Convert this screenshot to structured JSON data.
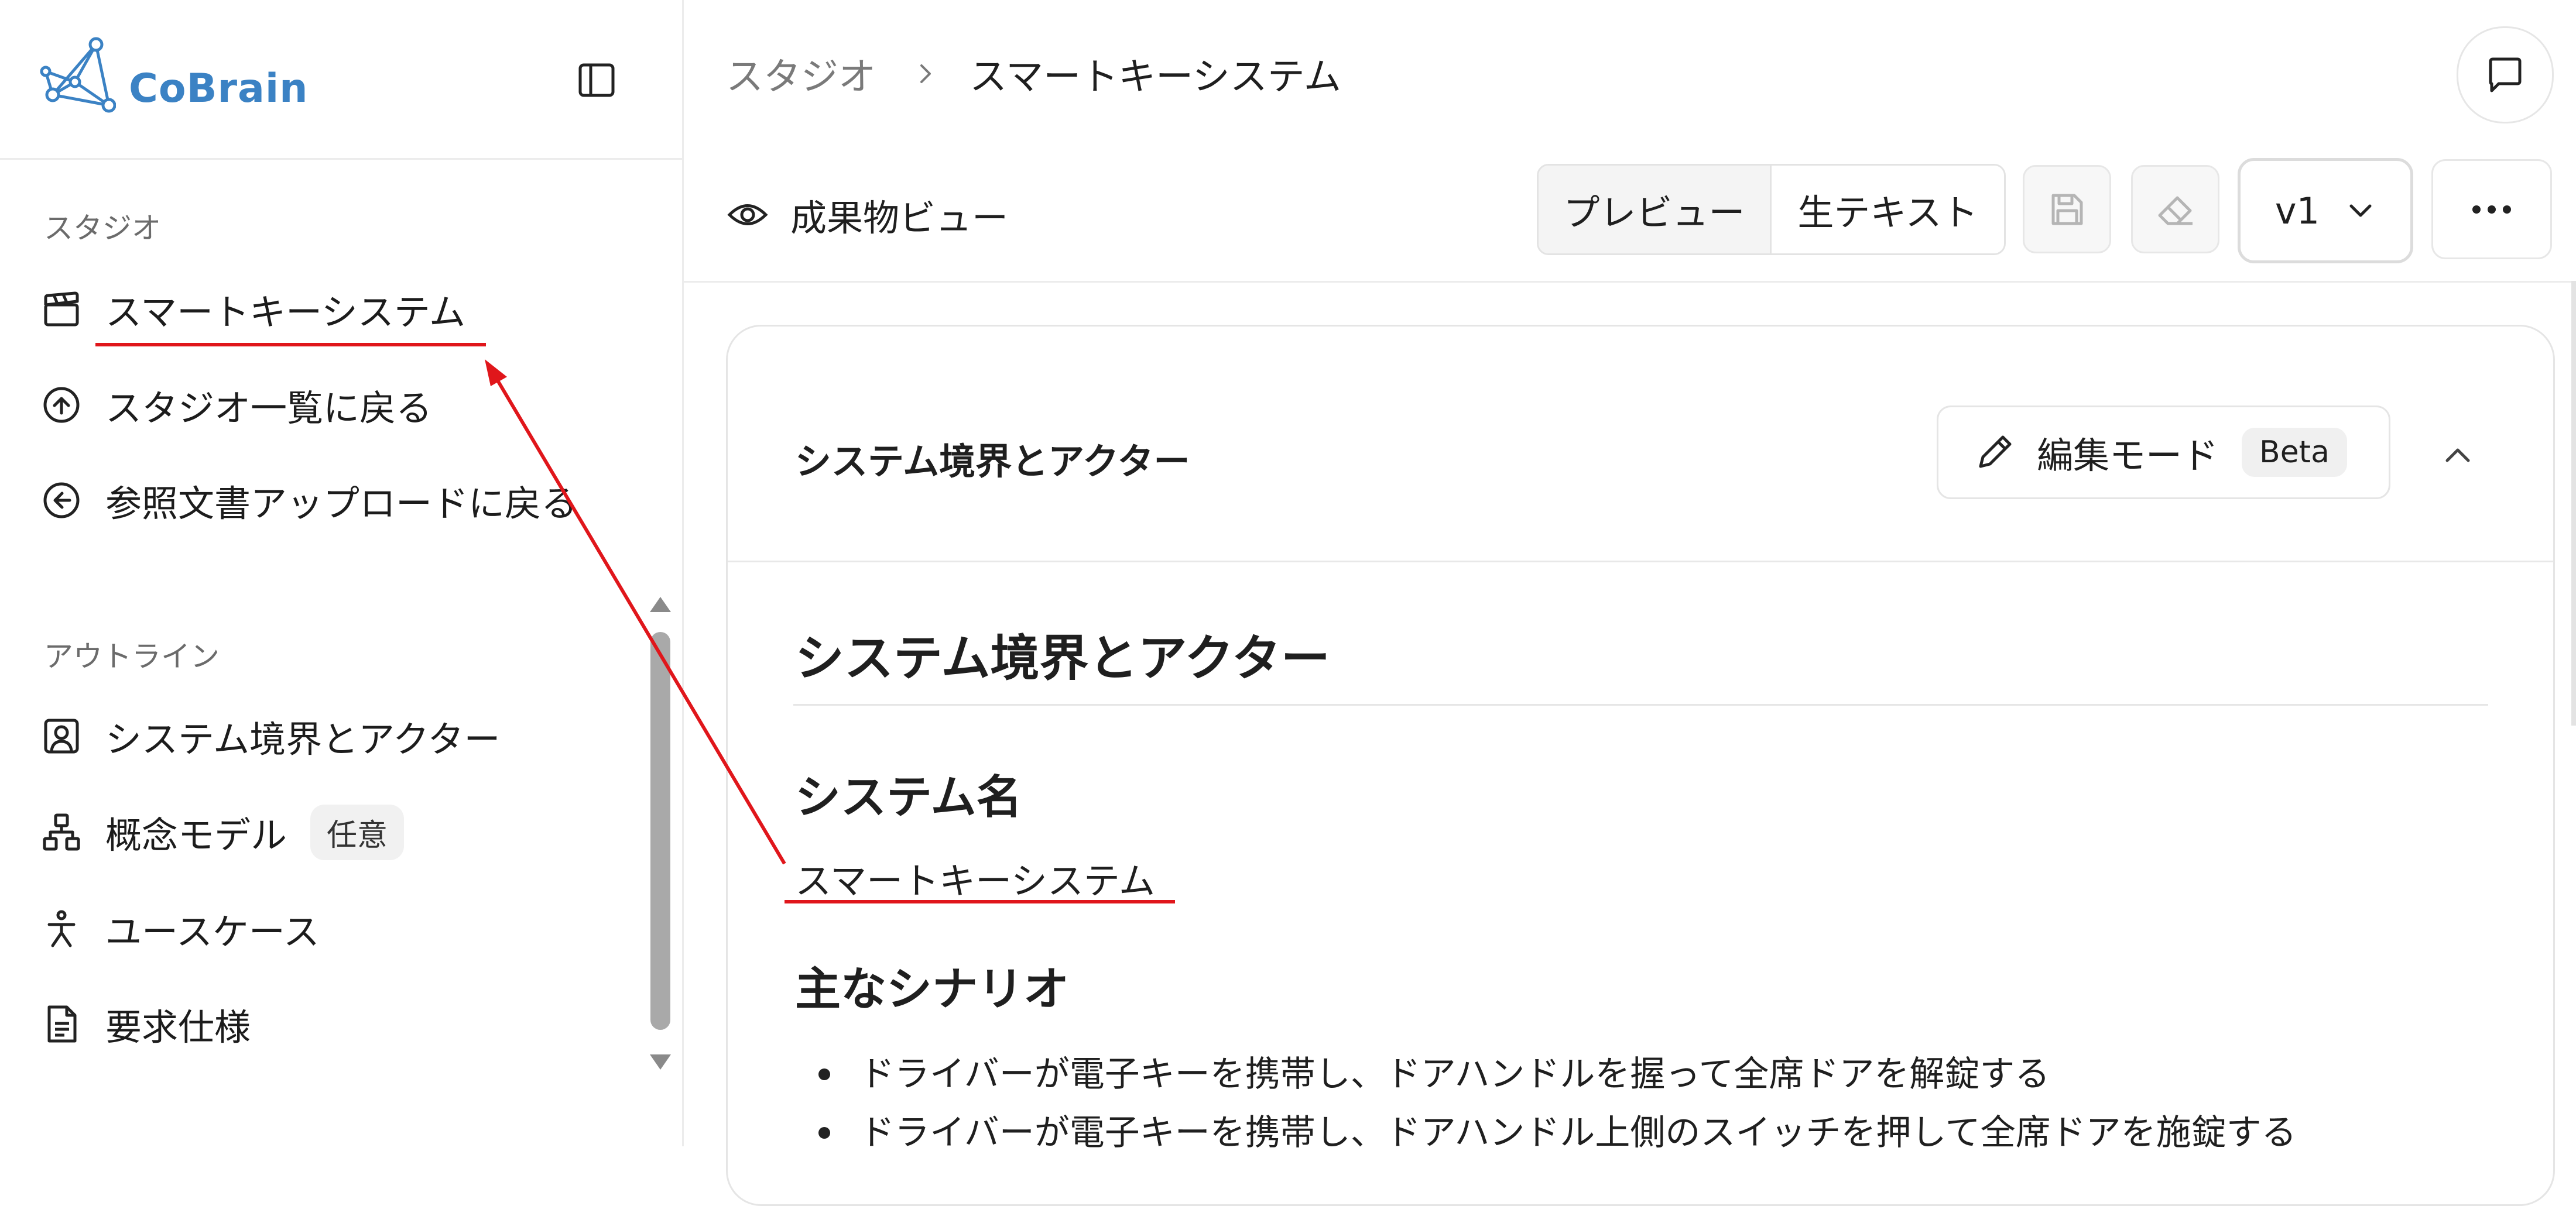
{
  "app": {
    "name": "CoBrain"
  },
  "sidebar": {
    "studio_section": "スタジオ",
    "studio_items": [
      {
        "label": "スマートキーシステム",
        "icon": "clapperboard-icon"
      },
      {
        "label": "スタジオ一覧に戻る",
        "icon": "circle-arrow-up-icon"
      },
      {
        "label": "参照文書アップロードに戻る",
        "icon": "circle-arrow-left-icon"
      }
    ],
    "outline_section": "アウトライン",
    "outline_items": [
      {
        "label": "システム境界とアクター",
        "icon": "user-square-icon"
      },
      {
        "label": "概念モデル",
        "badge": "任意",
        "icon": "network-icon"
      },
      {
        "label": "ユースケース",
        "icon": "person-icon"
      },
      {
        "label": "要求仕様",
        "icon": "document-icon"
      }
    ]
  },
  "breadcrumb": {
    "root": "スタジオ",
    "current": "スマートキーシステム"
  },
  "toolbar": {
    "view_label": "成果物ビュー",
    "preview_tab": "プレビュー",
    "raw_tab": "生テキスト",
    "version": "v1"
  },
  "card": {
    "title": "システム境界とアクター",
    "edit_label": "編集モード",
    "edit_badge": "Beta"
  },
  "document": {
    "h1": "システム境界とアクター",
    "system_name_heading": "システム名",
    "system_name": "スマートキーシステム",
    "scenario_heading": "主なシナリオ",
    "scenarios": [
      "ドライバーが電子キーを携帯し、ドアハンドルを握って全席ドアを解錠する",
      "ドライバーが電子キーを携帯し、ドアハンドル上側のスイッチを押して全席ドアを施錠する"
    ]
  },
  "colors": {
    "brand": "#3b82c4",
    "annotation": "#e0161b",
    "border": "#e5e5e5",
    "scrollbar": "#a9a9a9"
  }
}
